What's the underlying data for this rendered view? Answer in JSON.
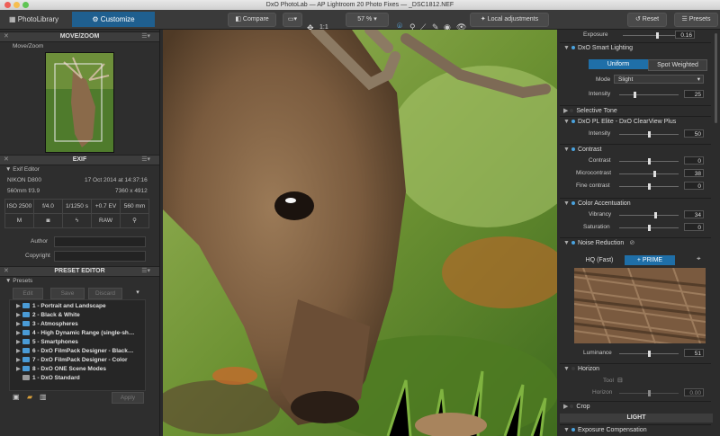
{
  "window": {
    "title": "DxO PhotoLab — AP Lightroom 20 Photo Fixes — _DSC1812.NEF"
  },
  "toolbar": {
    "tab_library": "PhotoLibrary",
    "tab_customize": "Customize",
    "compare": "Compare",
    "ratio": "1:1",
    "zoom": "57 %",
    "local_adjustments": "Local adjustments",
    "reset": "Reset",
    "presets": "Presets"
  },
  "left": {
    "movezoom": {
      "title": "MOVE/ZOOM",
      "label": "Move/Zoom"
    },
    "exif": {
      "title": "EXIF",
      "editor": "Exif Editor",
      "camera": "NIKON D800",
      "date": "17 Oct 2014 at 14:37:16",
      "lens": "560mm f/3.9",
      "dims": "7360 x 4912",
      "cells_row1": [
        "ISO 2500",
        "f/4.0",
        "1/1250 s",
        "+0.7 EV",
        "560 mm"
      ],
      "cells_row2": [
        "M",
        "",
        "",
        "RAW",
        ""
      ],
      "author_label": "Author",
      "copyright_label": "Copyright"
    },
    "preset_editor": {
      "title": "PRESET EDITOR",
      "presets_label": "Presets",
      "edit": "Edit",
      "save": "Save",
      "discard": "Discard",
      "items": [
        "1 - Portrait and Landscape",
        "2 - Black & White",
        "3 - Atmospheres",
        "4 - High Dynamic Range (single-sh…",
        "5 - Smartphones",
        "6 - DxO FilmPack Designer - Black…",
        "7 - DxO FilmPack Designer - Color",
        "8 - DxO ONE Scene Modes",
        "1 - DxO Standard"
      ],
      "apply": "Apply"
    }
  },
  "right": {
    "exposure": {
      "label": "Exposure",
      "value": "0.16",
      "level": 0.55
    },
    "smart_lighting": {
      "title": "DxO Smart Lighting",
      "uniform": "Uniform",
      "spot": "Spot Weighted",
      "mode_label": "Mode",
      "mode_value": "Slight",
      "intensity_label": "Intensity",
      "intensity_value": "25",
      "level": 0.25
    },
    "selective_tone": {
      "title": "Selective Tone"
    },
    "clearview": {
      "title": "DxO PL Elite - DxO ClearView Plus",
      "intensity_label": "Intensity",
      "intensity_value": "50",
      "level": 0.5
    },
    "contrast": {
      "title": "Contrast",
      "rows": [
        {
          "label": "Contrast",
          "value": "0",
          "level": 0.5
        },
        {
          "label": "Microcontrast",
          "value": "38",
          "level": 0.6
        },
        {
          "label": "Fine contrast",
          "value": "0",
          "level": 0.5
        }
      ]
    },
    "color_accentuation": {
      "title": "Color Accentuation",
      "rows": [
        {
          "label": "Vibrancy",
          "value": "34",
          "level": 0.62
        },
        {
          "label": "Saturation",
          "value": "0",
          "level": 0.5
        }
      ]
    },
    "noise": {
      "title": "Noise Reduction",
      "hq": "HQ (Fast)",
      "prime": "+ PRIME",
      "luminance_label": "Luminance",
      "luminance_value": "51",
      "level": 0.5
    },
    "horizon": {
      "title": "Horizon",
      "tool_label": "Tool",
      "horizon_label": "Horizon",
      "horizon_value": "0.00",
      "level": 0.5
    },
    "crop": {
      "title": "Crop"
    },
    "light_header": "LIGHT",
    "exposure_compensation": {
      "title": "Exposure Compensation"
    }
  }
}
